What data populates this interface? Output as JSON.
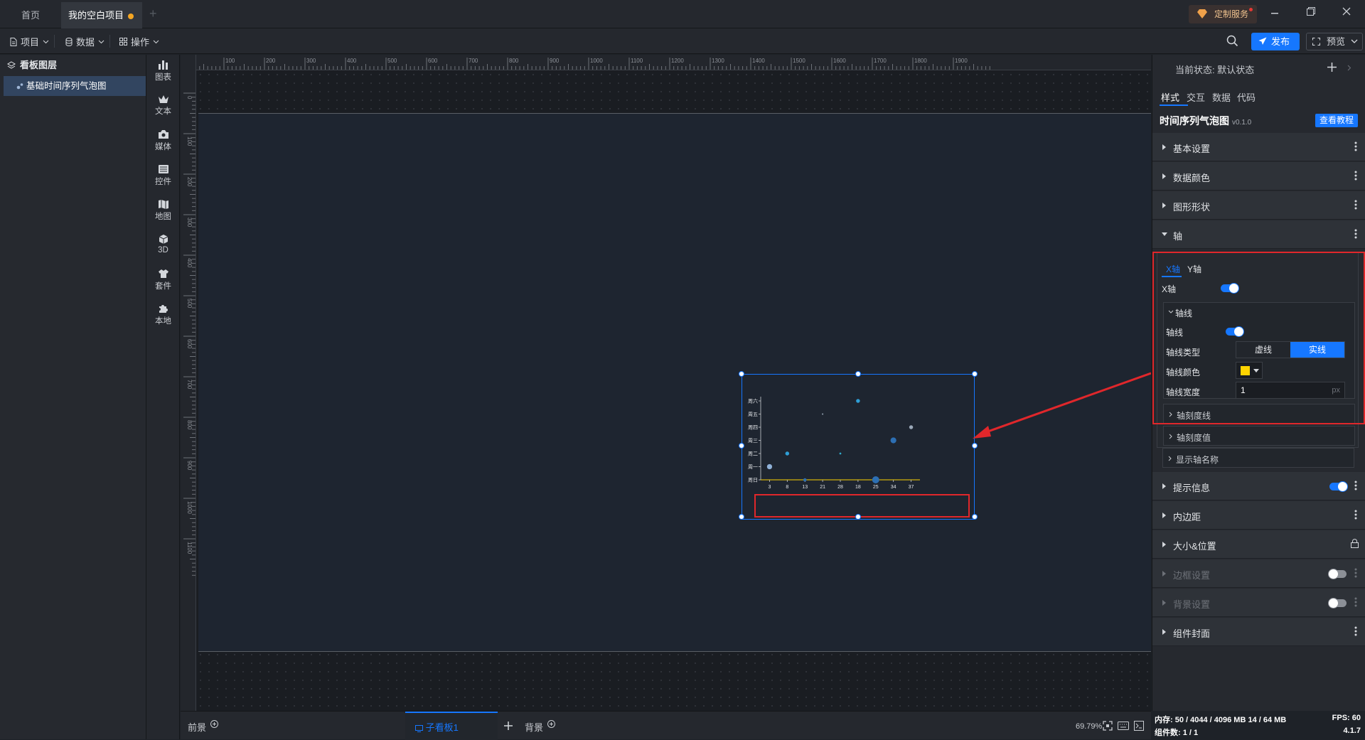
{
  "titlebar": {
    "tabs": [
      "首页",
      "我的空白项目"
    ],
    "service_label": "定制服务",
    "accent": "#1677ff"
  },
  "toolbar": {
    "menus": [
      "项目",
      "数据",
      "操作"
    ],
    "publish_label": "发布",
    "preview_label": "预览"
  },
  "layers": {
    "title": "看板图层",
    "items": [
      "基础时间序列气泡图"
    ]
  },
  "rail": [
    "图表",
    "文本",
    "媒体",
    "控件",
    "地图",
    "3D",
    "套件",
    "本地"
  ],
  "ruler": {
    "h_ticks": [
      "0",
      "100",
      "200",
      "300",
      "400",
      "500",
      "600",
      "700",
      "800",
      "900",
      "1000",
      "1100",
      "1200",
      "1300",
      "1400",
      "1500",
      "1600",
      "1700",
      "1800",
      "1900"
    ],
    "v_ticks": [
      "0",
      "100",
      "200",
      "300",
      "400",
      "500",
      "600",
      "700",
      "800",
      "900",
      "1000",
      "1100"
    ]
  },
  "chart_data": {
    "type": "scatter",
    "title": "",
    "x_categories": [
      "3",
      "8",
      "13",
      "21",
      "28",
      "18",
      "25",
      "34",
      "37"
    ],
    "y_categories": [
      "周日",
      "周一",
      "周二",
      "周三",
      "周四",
      "周五",
      "周六"
    ],
    "y_labels_visible": [
      "周日",
      "周一",
      "周二",
      "周三",
      "周四",
      "周五",
      "周六"
    ],
    "points": [
      {
        "x": "3",
        "y": "周一",
        "size": 8
      },
      {
        "x": "8",
        "y": "周二",
        "size": 6
      },
      {
        "x": "13",
        "y": "周日",
        "size": 5
      },
      {
        "x": "21",
        "y": "周五",
        "size": 2
      },
      {
        "x": "28",
        "y": "周二",
        "size": 3
      },
      {
        "x": "18",
        "y": "周六",
        "size": 6
      },
      {
        "x": "25",
        "y": "周日",
        "size": 11
      },
      {
        "x": "34",
        "y": "周三",
        "size": 9
      },
      {
        "x": "37",
        "y": "周四",
        "size": 6
      }
    ],
    "axis_line_color": "#ffd400",
    "grid": false
  },
  "bottom": {
    "tabs": [
      "前景",
      "子看板1",
      "背景"
    ],
    "zoom": "69.79%"
  },
  "rpanel": {
    "state_label": "当前状态:  默认状态",
    "tabs": [
      "样式",
      "交互",
      "数据",
      "代码"
    ],
    "component_name": "时间序列气泡图",
    "component_version": "v0.1.0",
    "tutorial_label": "查看教程",
    "sections_top": [
      "基本设置",
      "数据颜色",
      "图形形状",
      "轴"
    ],
    "axis": {
      "subtabs": [
        "X轴",
        "Y轴"
      ],
      "x_axis_label": "X轴",
      "axis_line_group": "轴线",
      "axis_line_label": "轴线",
      "line_type_label": "轴线类型",
      "line_type_options": [
        "虚线",
        "实线"
      ],
      "line_color_label": "轴线颜色",
      "line_color": "#ffd400",
      "line_width_label": "轴线宽度",
      "line_width_value": "1",
      "line_width_unit": "px",
      "collapsed": [
        "轴刻度线",
        "轴刻度值",
        "显示轴名称"
      ]
    },
    "sections_bottom": [
      "提示信息",
      "内边距",
      "大小&位置",
      "边框设置",
      "背景设置",
      "组件封面"
    ]
  },
  "status": {
    "memory": "内存:  50 / 4044 / 4096 MB  14 / 64 MB",
    "fps": "FPS:  60",
    "count": "组件数: 1 / 1",
    "version": "4.1.7"
  }
}
